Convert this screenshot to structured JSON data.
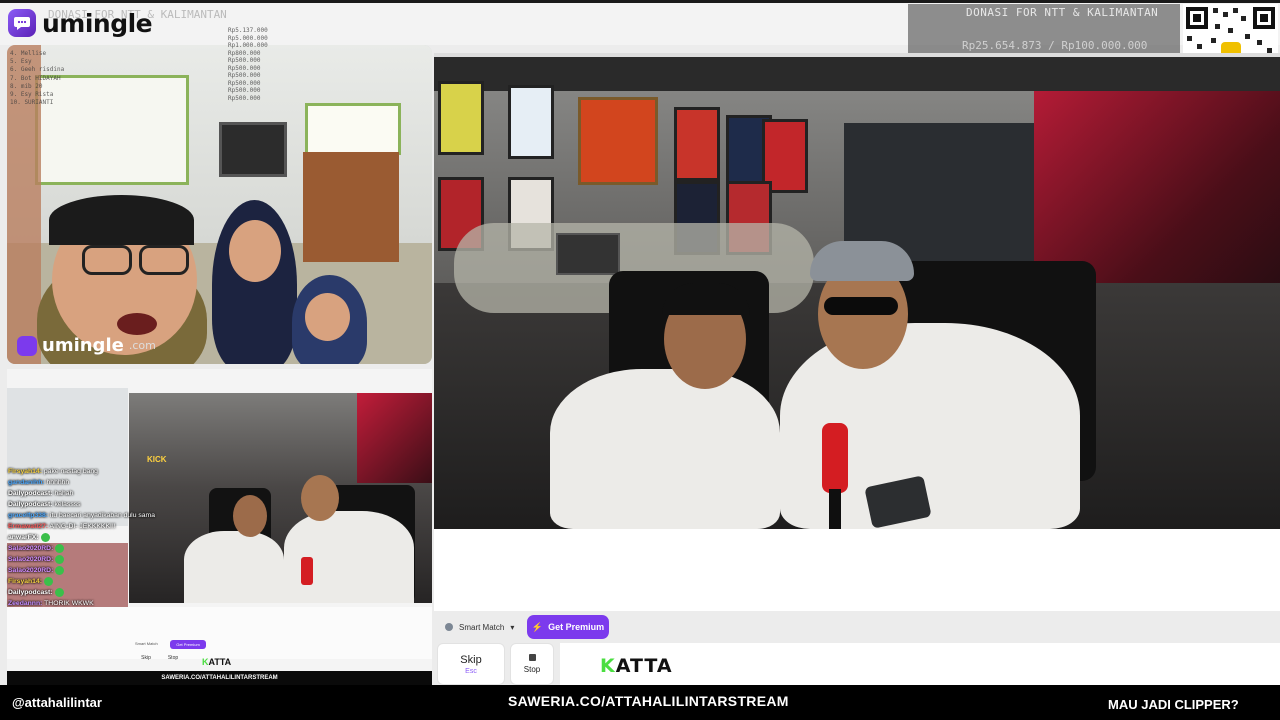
{
  "app": {
    "logo_text": "umingle",
    "watermark_text": "umingle",
    "watermark_suffix": ".com"
  },
  "donation": {
    "title": "DONASI FOR NTT & KALIMANTAN",
    "amount": "Rp25.654.873 / Rp100.000.000",
    "ghost_title": "DONASI FOR NTT & KALIMANTAN"
  },
  "ghost_chat": {
    "names": [
      "4. Mellise",
      "5. Esy",
      "6. Geeh risdina",
      "7. Bot HIDAYAH",
      "8. mib 20",
      "9. Esy Rista",
      "10. SURIANTI"
    ],
    "values": [
      "Rp5.137.000",
      "Rp5.000.000",
      "Rp1.000.000",
      "Rp800.000",
      "Rp500.000",
      "Rp500.000",
      "Rp500.000",
      "Rp500.000",
      "Rp500.000",
      "Rp500.000"
    ]
  },
  "controls": {
    "smart_match": "Smart Match",
    "get_premium": "Get Premium",
    "skip_label": "Skip",
    "skip_hint": "Esc",
    "stop_label": "Stop"
  },
  "chat_text": "KATTA",
  "nested": {
    "kick_label": "KICK",
    "smart_match": "Smart Match",
    "get_premium": "Get Premium",
    "skip": "Skip",
    "stop": "Stop",
    "katta": "KATTA",
    "saweria": "SAWERIA.CO/ATTAHALILINTARSTREAM"
  },
  "chat": [
    {
      "user": "Firsyah14:",
      "text": "pake nastag bang",
      "color": "#f5d142"
    },
    {
      "user": "gandanihh:",
      "text": "hhhhhh",
      "color": "#4aa8ff"
    },
    {
      "user": "Dailypodcast:",
      "text": "hahah",
      "color": "#ffffff"
    },
    {
      "user": "Dailypodcast:",
      "text": "kelassss",
      "color": "#ffffff"
    },
    {
      "user": "gracelfp338:",
      "text": "itu baecari anyadikaban dulu sama",
      "color": "#4aa8ff"
    },
    {
      "user": "Ermawati27:",
      "text": "AING-DI- JEKKKKK!!!",
      "color": "#ff5a5a"
    },
    {
      "user": "anwarFX:",
      "text": "",
      "color": "#ffffff"
    },
    {
      "user": "Salao2020RD:",
      "text": "",
      "color": "#d08cff"
    },
    {
      "user": "Salao2020RD:",
      "text": "",
      "color": "#d08cff"
    },
    {
      "user": "Salao2020RD:",
      "text": "",
      "color": "#d08cff"
    },
    {
      "user": "Firsyah14:",
      "text": "",
      "color": "#f5d142"
    },
    {
      "user": "Dailypodcast:",
      "text": "",
      "color": "#ffffff"
    },
    {
      "user": "Zeedannn:",
      "text": "THORIK WKWK",
      "color": "#c18cff"
    }
  ],
  "banner": {
    "handle": "@attahalilintar",
    "saweria": "SAWERIA.CO/ATTAHALILINTARSTREAM",
    "clipper": "MAU JADI CLIPPER?"
  },
  "colors": {
    "accent": "#7c3aed",
    "katta_k": "#4ade40",
    "banner_bg": "#000000"
  }
}
